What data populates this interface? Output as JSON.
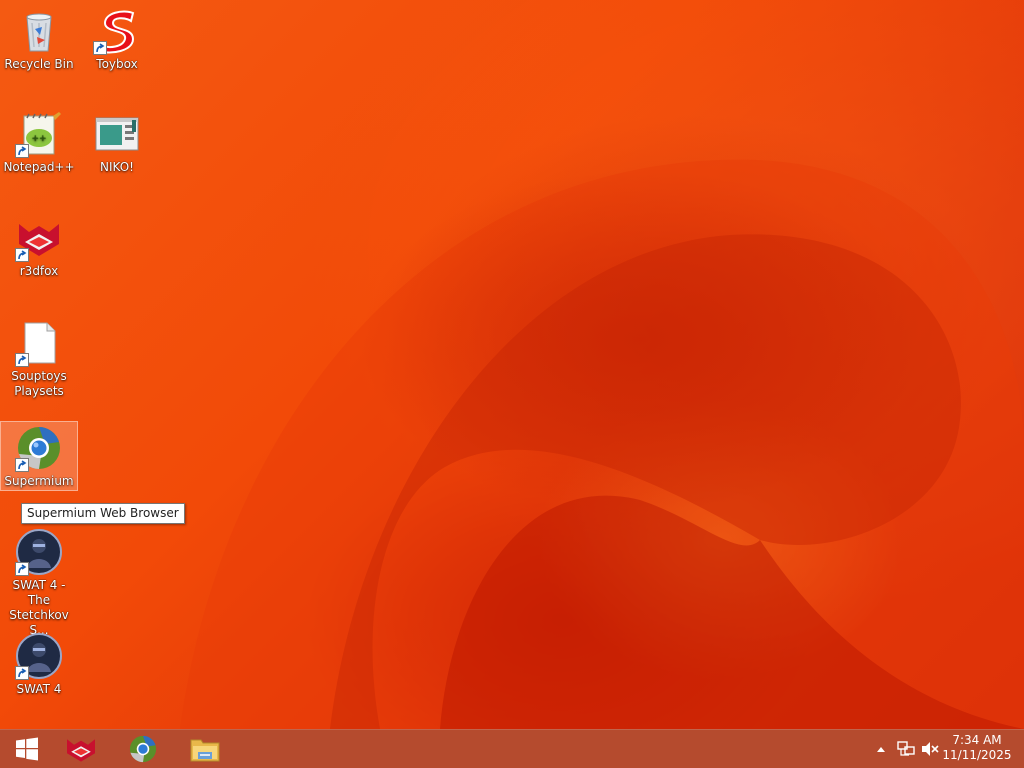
{
  "desktop": {
    "icons": [
      {
        "label": "Recycle Bin",
        "icon": "recycle-bin-icon"
      },
      {
        "label": "Toybox",
        "icon": "toybox-icon"
      },
      {
        "label": "Notepad++",
        "icon": "notepad-plus-plus-icon"
      },
      {
        "label": "NIKO!",
        "icon": "niko-icon"
      },
      {
        "label": "r3dfox",
        "icon": "r3dfox-icon"
      },
      {
        "label": "Souptoys Playsets",
        "icon": "document-icon"
      },
      {
        "label": "Supermium",
        "icon": "supermium-icon"
      },
      {
        "label": "SWAT 4 - The Stetchkov S...",
        "icon": "swat4-icon"
      },
      {
        "label": "SWAT 4",
        "icon": "swat4-icon"
      }
    ],
    "tooltip": "Supermium Web Browser"
  },
  "taskbar": {
    "pinned": [
      {
        "name": "start",
        "icon": "windows-logo-icon"
      },
      {
        "name": "r3dfox",
        "icon": "r3dfox-icon"
      },
      {
        "name": "supermium",
        "icon": "supermium-icon"
      },
      {
        "name": "file-explorer",
        "icon": "folder-icon"
      }
    ],
    "tray": {
      "icons": [
        "chevron-up-icon",
        "network-icon",
        "volume-muted-icon"
      ]
    },
    "clock": {
      "time": "7:34 AM",
      "date": "11/11/2025"
    }
  },
  "colors": {
    "wallpaper_base": "#f24a08",
    "taskbar": "#af3c1c",
    "selection": "#ffffff"
  }
}
